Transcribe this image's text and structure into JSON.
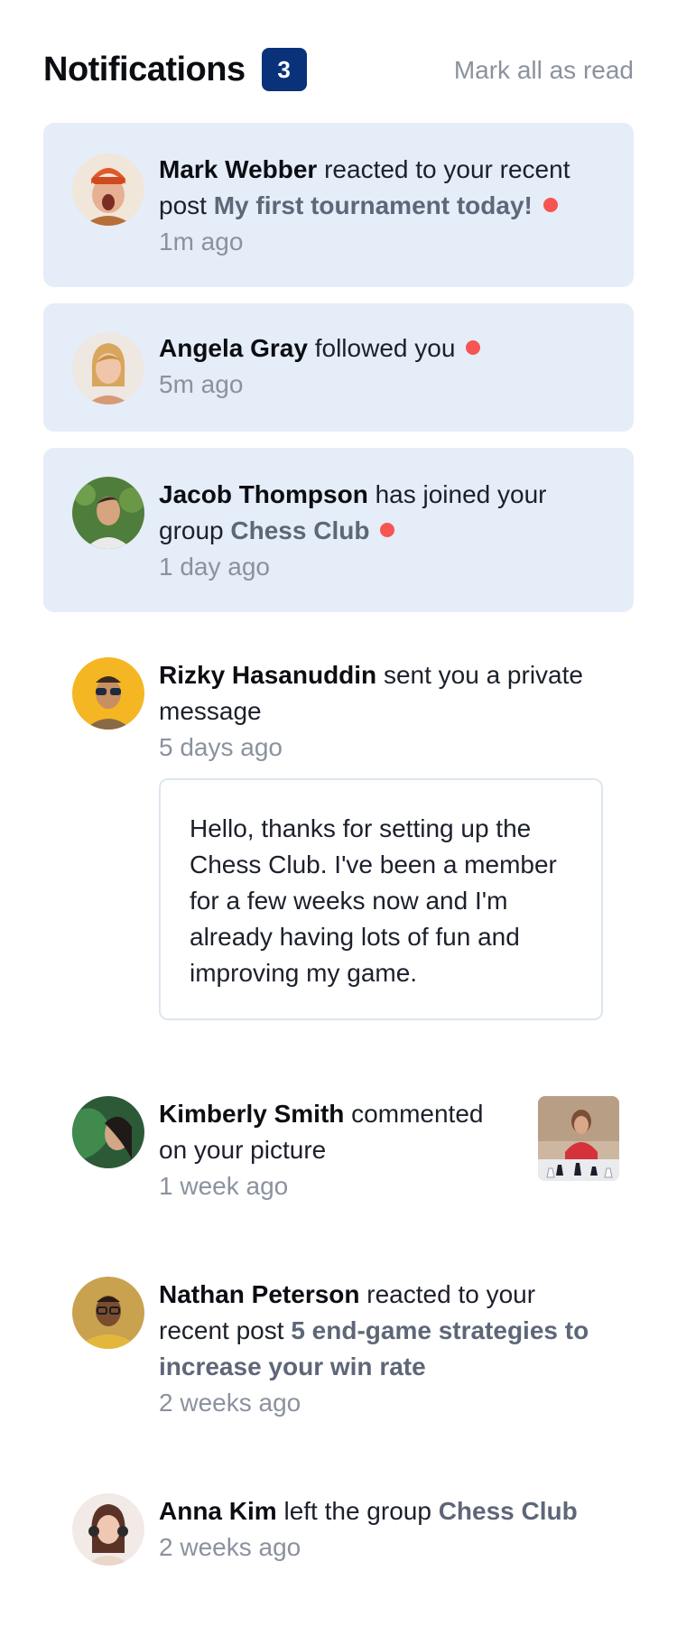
{
  "header": {
    "title": "Notifications",
    "unread_count": "3",
    "mark_all_label": "Mark all as read"
  },
  "colors": {
    "badge": "#0a327b",
    "unread_background": "#e5edf8",
    "unread_dot": "#f65552",
    "muted_text": "#8b929e",
    "target_text": "#5e6778"
  },
  "notifications": [
    {
      "name": "Mark Webber",
      "action": "reacted to your recent post",
      "target": "My first tournament today!",
      "time": "1m ago",
      "unread": true,
      "avatar": "avatar-icon"
    },
    {
      "name": "Angela Gray",
      "action": "followed you",
      "target": "",
      "time": "5m ago",
      "unread": true,
      "avatar": "avatar-icon"
    },
    {
      "name": "Jacob Thompson",
      "action": "has joined your group",
      "target": "Chess Club",
      "time": "1 day ago",
      "unread": true,
      "avatar": "avatar-icon"
    },
    {
      "name": "Rizky Hasanuddin",
      "action": "sent you a private message",
      "target": "",
      "time": "5 days ago",
      "unread": false,
      "avatar": "avatar-icon",
      "message": "Hello, thanks for setting up the Chess Club. I've been a member for a few weeks now and I'm already having lots of fun and improving my game."
    },
    {
      "name": "Kimberly Smith",
      "action": "commented on your picture",
      "target": "",
      "time": "1 week ago",
      "unread": false,
      "avatar": "avatar-icon",
      "thumbnail": "chess-photo-thumbnail"
    },
    {
      "name": "Nathan Peterson",
      "action": "reacted to your recent post",
      "target": "5 end-game strategies to increase your win rate",
      "time": "2 weeks ago",
      "unread": false,
      "avatar": "avatar-icon"
    },
    {
      "name": "Anna Kim",
      "action": "left the group",
      "target": "Chess Club",
      "time": "2 weeks ago",
      "unread": false,
      "avatar": "avatar-icon"
    }
  ]
}
